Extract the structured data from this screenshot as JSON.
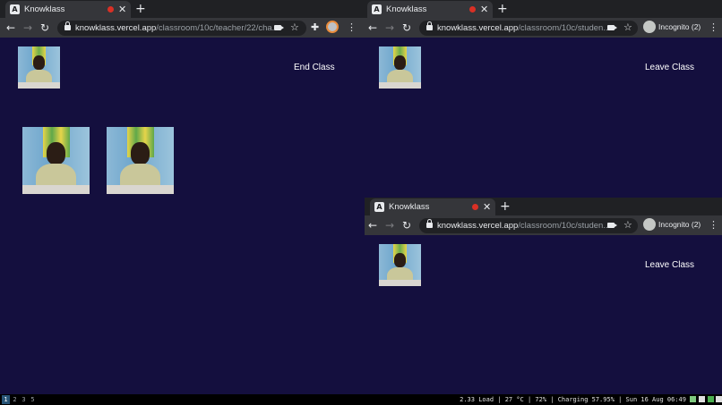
{
  "tab_favicon_glyph": "A",
  "windows": [
    {
      "tab_title": "Knowklass",
      "url_host": "knowklass.vercel.app",
      "url_path": "/classroom/10c/teacher/22/cha...",
      "action_label": "End Class"
    },
    {
      "tab_title": "Knowklass",
      "url_host": "knowklass.vercel.app",
      "url_path": "/classroom/10c/studen...",
      "incognito_label": "Incognito (2)",
      "action_label": "Leave Class"
    },
    {
      "tab_title": "Knowklass",
      "url_host": "knowklass.vercel.app",
      "url_path": "/classroom/10c/studen...",
      "incognito_label": "Incognito (2)",
      "action_label": "Leave Class"
    }
  ],
  "statusbar": {
    "workspaces": [
      "1",
      "2",
      "3",
      "5"
    ],
    "status_text": "2.33 Load | 27 °C | 72% | Charging 57.95% | Sun 16 Aug 06:49"
  },
  "colors": {
    "page_background": "#140f3e",
    "browser_chrome": "#35363a",
    "recording_dot": "#d93025",
    "active_workspace": "#285577"
  }
}
